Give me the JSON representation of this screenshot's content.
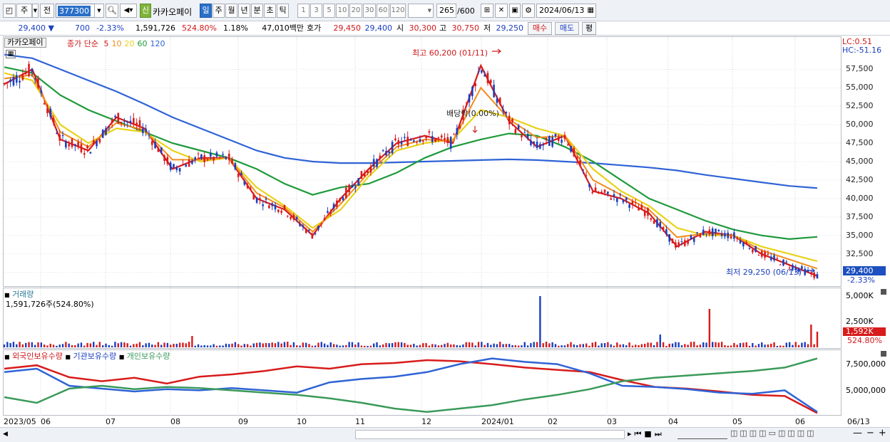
{
  "toolbar": {
    "period_short": "주",
    "prev_label": "전",
    "stock_code": "377300",
    "new_badge": "신",
    "stock_name": "카카오페이",
    "periods": [
      "일",
      "주",
      "월",
      "년",
      "분",
      "초",
      "틱"
    ],
    "active_period": "일",
    "intervals": [
      "1",
      "3",
      "5",
      "10",
      "20",
      "30",
      "60",
      "120"
    ],
    "count_value": "265",
    "count_max": "/600",
    "date": "2024/06/13"
  },
  "quote": {
    "price": "29,400",
    "change_arrow": "▼",
    "change": "700",
    "change_pct": "-2.33%",
    "volume": "1,591,726",
    "volume_ratio": "524.80%",
    "turnover": "1.18%",
    "amount": "47,010백만",
    "bid_label": "호가",
    "bid": "29,450",
    "ask": "29,400",
    "open_label": "시",
    "open": "30,300",
    "high_label": "고",
    "high": "30,750",
    "low_label": "저",
    "low": "29,250",
    "buy_button": "매수",
    "sell_button": "매도",
    "eval_button": "평"
  },
  "price_pane": {
    "stock_tag": "카카오페이",
    "legend_title": "종가 단순",
    "ma_periods": [
      "5",
      "10",
      "20",
      "60",
      "120"
    ],
    "ma_colors": [
      "#d81b1b",
      "#f28c1c",
      "#e8d21a",
      "#1e9a3b",
      "#2f63d6"
    ],
    "lc": "LC:0.51",
    "hc": "HC:-51.16",
    "y_ticks": [
      "57,500",
      "55,000",
      "52,500",
      "50,000",
      "47,500",
      "45,000",
      "42,500",
      "40,000",
      "37,500",
      "35,000",
      "32,500",
      "30,000"
    ],
    "last_price_box": "29,400",
    "last_change": "-2.33%",
    "annotation_high": "최고 60,200 (01/11)",
    "annotation_low": "최저 29,250 (06/13)",
    "annotation_dividend": "배당락(0.00%)"
  },
  "volume_pane": {
    "title": "거래량",
    "value": "1,591,726주(524.80%)",
    "y_ticks": [
      "5,000K",
      "2,500K"
    ],
    "last_box": "1,592K",
    "last_ratio": "524.80%"
  },
  "holding_pane": {
    "legends": [
      "외국인보유수량",
      "기관보유수량",
      "개인보유수량"
    ],
    "colors": [
      "#d81b1b",
      "#2f63d6",
      "#3a9a5a"
    ],
    "y_ticks": [
      "7,500,000",
      "5,000,000"
    ]
  },
  "x_axis": {
    "labels": [
      "2023/05",
      "06",
      "07",
      "08",
      "09",
      "10",
      "11",
      "12",
      "2024/01",
      "02",
      "03",
      "04",
      "05",
      "06",
      "06/13"
    ]
  },
  "chart_data": {
    "type": "line",
    "x_range": [
      "2023/05",
      "2024/06/13"
    ],
    "ylim": [
      29250,
      60200
    ],
    "series": [
      {
        "name": "5",
        "values": [
          55500,
          57500,
          48000,
          46500,
          51000,
          49500,
          44000,
          45500,
          45500,
          40000,
          38500,
          35000,
          40000,
          44000,
          47500,
          48500,
          47500,
          58000,
          50500,
          47000,
          48500,
          41000,
          40000,
          38000,
          33500,
          35500,
          35000,
          32500,
          31000,
          29500
        ]
      },
      {
        "name": "20",
        "values": [
          57000,
          56000,
          50000,
          47500,
          49500,
          49000,
          46500,
          45000,
          45500,
          41500,
          39000,
          36000,
          38500,
          43000,
          46500,
          47500,
          48000,
          52000,
          51000,
          49500,
          48500,
          44000,
          41000,
          39000,
          36000,
          35000,
          35000,
          33500,
          32500,
          31500
        ]
      },
      {
        "name": "60",
        "values": [
          57800,
          57000,
          54000,
          52000,
          50500,
          49000,
          47500,
          46500,
          45500,
          44000,
          42000,
          40500,
          41500,
          42000,
          43500,
          45500,
          47000,
          48000,
          48800,
          48500,
          47000,
          45000,
          42500,
          40000,
          38500,
          37000,
          35800,
          35000,
          34500,
          34800
        ]
      },
      {
        "name": "120",
        "values": [
          59500,
          59000,
          57500,
          56000,
          54500,
          52800,
          51000,
          49500,
          48000,
          46500,
          45500,
          45000,
          44800,
          44800,
          44900,
          45000,
          45100,
          45200,
          45300,
          45200,
          45000,
          44800,
          44500,
          44200,
          43800,
          43200,
          42700,
          42200,
          41700,
          41400
        ]
      }
    ]
  }
}
